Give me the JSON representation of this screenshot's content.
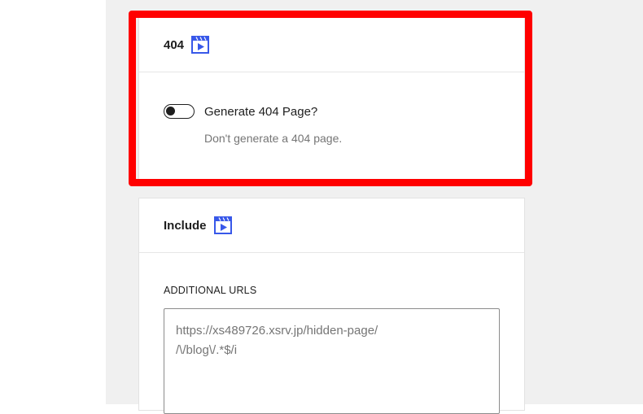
{
  "cards": {
    "not_found": {
      "title": "404",
      "toggle_label": "Generate 404 Page?",
      "help_text": "Don't generate a 404 page."
    },
    "include": {
      "title": "Include",
      "additional_urls_label": "ADDITIONAL URLS",
      "additional_urls_value": "https://xs489726.xsrv.jp/hidden-page/\n/\\/blog\\/.*$/i"
    }
  },
  "icons": {
    "section_help": "video-icon"
  },
  "colors": {
    "highlight": "#ff0000",
    "icon_blue": "#3858e9"
  }
}
